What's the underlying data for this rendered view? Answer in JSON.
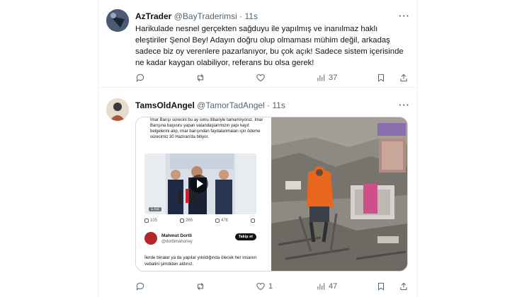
{
  "tweets": [
    {
      "name": "AzTrader",
      "handle": "@BayTraderimsi",
      "separator": "·",
      "time": "11s",
      "more": "···",
      "text": "Harikulade nesnel gerçekten sağduyu ile yapılmış ve inanılmaz haklı eleştiriler Şenol Bey! Adayın doğru olup olmaması mühim değil, arkadaş sadece biz oy verenlere pazarlanıyor, bu çok açık! Sadece sistem içerisinde ne kadar kaygan olabiliyor, referans bu olsa gerek!",
      "actions": {
        "reply": "",
        "retweet": "",
        "like": "",
        "views": "37"
      }
    },
    {
      "name": "TamsOldAngel",
      "handle": "@TamorTadAngel",
      "separator": "·",
      "time": "11s",
      "more": "···",
      "actions": {
        "reply": "",
        "retweet": "",
        "like": "1",
        "views": "47"
      },
      "quoted": {
        "text": "İmar Barışı sürecini bu ay sonu itibariyle tamamlıyoruz. İmar Barışına başvuru yapan vatandaşlarımızın yapı kayıt belgelerini alıp, imar barışından faydalanmaları için ödeme sürecimiz 30 Haziran'da bitiyor.",
        "video_time": "1:02",
        "stats": [
          "105",
          "265",
          "476",
          ""
        ],
        "reply_author": "Mahmut Dortli",
        "reply_handle": "@dortlimahoney",
        "follow_label": "Takip et",
        "reply_text": "İlerde binalar ya da yapılar yıkıldığında ölecek her insanın vebalini şimdiden aldınız."
      }
    }
  ],
  "colors": {
    "text": "#0f1419",
    "muted": "#536471",
    "border": "#eff3f4",
    "safety_orange": "#e8661e"
  }
}
